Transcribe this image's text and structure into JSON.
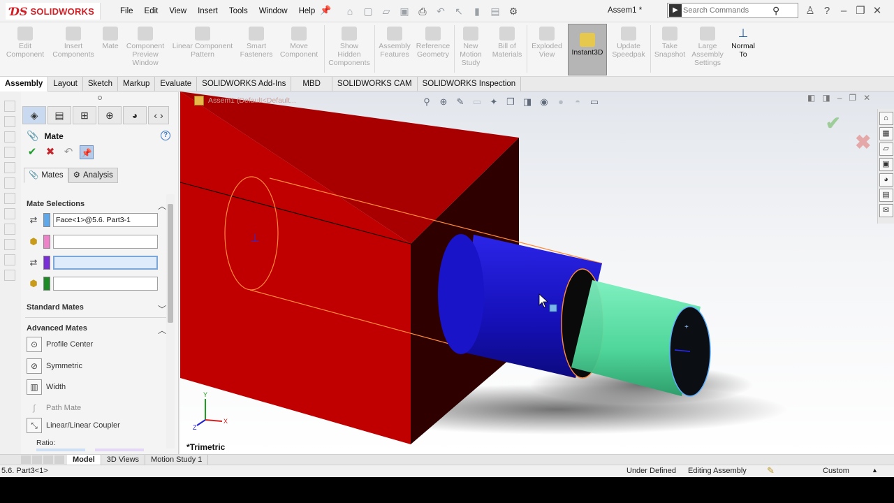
{
  "app": {
    "brand": "SOLIDWORKS",
    "doc_title": "Assem1 *"
  },
  "menu": [
    "File",
    "Edit",
    "View",
    "Insert",
    "Tools",
    "Window",
    "Help"
  ],
  "search": {
    "placeholder": "Search Commands"
  },
  "ribbon": {
    "buttons": [
      {
        "label": "Edit\nComponent",
        "enabled": false
      },
      {
        "label": "Insert\nComponents",
        "enabled": false
      },
      {
        "label": "Mate",
        "enabled": false
      },
      {
        "label": "Component\nPreview\nWindow",
        "enabled": false
      },
      {
        "label": "Linear Component\nPattern",
        "enabled": false
      },
      {
        "label": "Smart\nFasteners",
        "enabled": false
      },
      {
        "label": "Move\nComponent",
        "enabled": false
      },
      {
        "label": "Show\nHidden\nComponents",
        "enabled": false
      },
      {
        "label": "Assembly\nFeatures",
        "enabled": false
      },
      {
        "label": "Reference\nGeometry",
        "enabled": false
      },
      {
        "label": "New\nMotion\nStudy",
        "enabled": false
      },
      {
        "label": "Bill of\nMaterials",
        "enabled": false
      },
      {
        "label": "Exploded\nView",
        "enabled": false
      },
      {
        "label": "Instant3D",
        "enabled": true
      },
      {
        "label": "Update\nSpeedpak",
        "enabled": false
      },
      {
        "label": "Take\nSnapshot",
        "enabled": false
      },
      {
        "label": "Large\nAssembly\nSettings",
        "enabled": false
      },
      {
        "label": "Normal\nTo",
        "enabled": true
      }
    ]
  },
  "tabs": [
    "Assembly",
    "Layout",
    "Sketch",
    "Markup",
    "Evaluate",
    "SOLIDWORKS Add-Ins",
    "MBD",
    "SOLIDWORKS CAM",
    "SOLIDWORKS Inspection"
  ],
  "active_tab": "Assembly",
  "property_manager": {
    "title": "Mate",
    "subtabs": [
      "Mates",
      "Analysis"
    ],
    "mate_selections": {
      "header": "Mate Selections",
      "rows": [
        {
          "value": "Face<1>@5.6. Part3-1",
          "color": "#5ea7e8"
        },
        {
          "value": "",
          "color": "#ee82c8"
        },
        {
          "value": "",
          "color": "#7a2fd6"
        },
        {
          "value": "",
          "color": "#1e8a26"
        }
      ]
    },
    "standard_mates": {
      "header": "Standard Mates"
    },
    "advanced_mates": {
      "header": "Advanced Mates",
      "items": [
        "Profile Center",
        "Symmetric",
        "Width",
        "Path Mate",
        "Linear/Linear Coupler"
      ]
    },
    "ratio_label": "Ratio:"
  },
  "viewport": {
    "tree_label": "Assem1  (Default<Default...",
    "view_name": "*Trimetric",
    "triad": {
      "x": "X",
      "y": "Y",
      "z": "Z"
    }
  },
  "bottom_tabs": [
    "Model",
    "3D Views",
    "Motion Study 1"
  ],
  "active_bottom_tab": "Model",
  "status": {
    "selection": "5.6. Part3<1>",
    "definition": "Under Defined",
    "mode": "Editing Assembly",
    "units": "Custom"
  },
  "colors": {
    "block_front": "#c00000",
    "block_side": "#2e0000",
    "cylinder_blue": "#1a14c8",
    "cylinder_green": "#55e3a4",
    "selection_outline": "#ff8a3a"
  }
}
